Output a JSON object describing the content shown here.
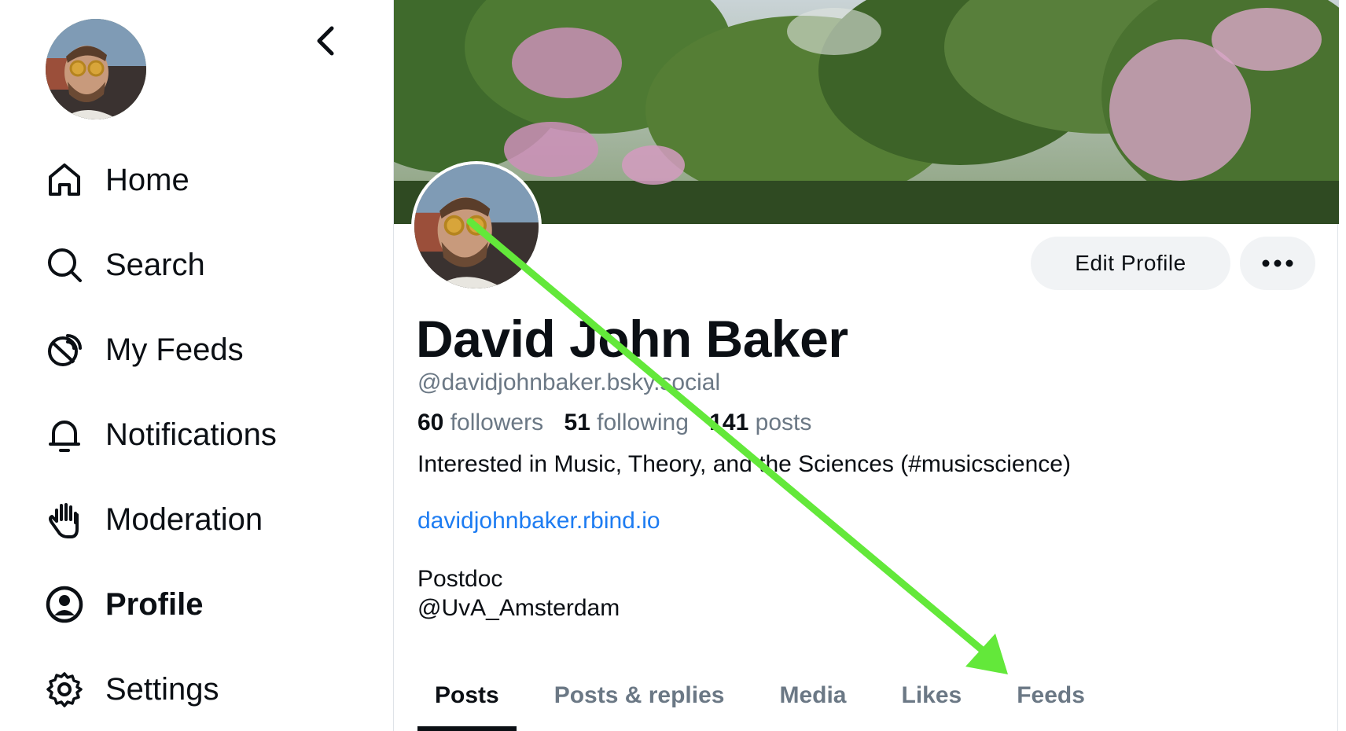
{
  "sidebar": {
    "items": [
      {
        "label": "Home",
        "icon": "home-icon",
        "active": false
      },
      {
        "label": "Search",
        "icon": "search-icon",
        "active": false
      },
      {
        "label": "My Feeds",
        "icon": "feeds-icon",
        "active": false
      },
      {
        "label": "Notifications",
        "icon": "bell-icon",
        "active": false
      },
      {
        "label": "Moderation",
        "icon": "hand-icon",
        "active": false
      },
      {
        "label": "Profile",
        "icon": "user-circle-icon",
        "active": true
      },
      {
        "label": "Settings",
        "icon": "gear-icon",
        "active": false
      }
    ]
  },
  "profile": {
    "display_name": "David John Baker",
    "handle": "@davidjohnbaker.bsky.social",
    "stats": {
      "followers_count": "60",
      "followers_label": "followers",
      "following_count": "51",
      "following_label": "following",
      "posts_count": "141",
      "posts_label": "posts"
    },
    "bio_line": "Interested in Music, Theory, and the Sciences (#musicscience)",
    "link": "davidjohnbaker.rbind.io",
    "role_line1": "Postdoc",
    "role_line2": "@UvA_Amsterdam"
  },
  "actions": {
    "edit_profile_label": "Edit Profile"
  },
  "tabs": [
    {
      "label": "Posts",
      "active": true
    },
    {
      "label": "Posts & replies",
      "active": false
    },
    {
      "label": "Media",
      "active": false
    },
    {
      "label": "Likes",
      "active": false
    },
    {
      "label": "Feeds",
      "active": false
    }
  ],
  "colors": {
    "accent_link": "#1d7cf2",
    "annotation_arrow": "#63e83a",
    "muted_text": "#6b7885",
    "button_bg": "#f1f3f5"
  }
}
